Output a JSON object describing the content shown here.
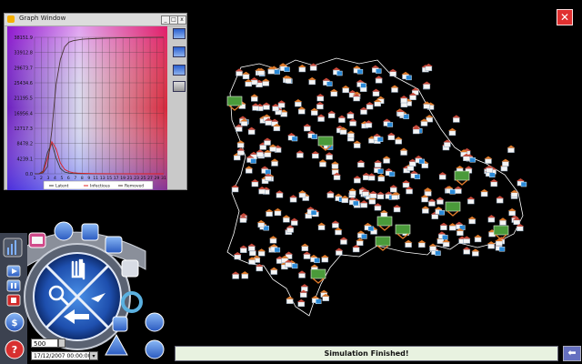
{
  "graph_window": {
    "title": "Graph Window",
    "y_ticks": [
      "38151.9",
      "33912.8",
      "29673.7",
      "25434.6",
      "21195.5",
      "16956.4",
      "12717.3",
      "8478.2",
      "4239.1",
      "0.0"
    ],
    "x_ticks": [
      "1",
      "2",
      "3",
      "4",
      "5",
      "6",
      "7",
      "8",
      "9",
      "11",
      "13",
      "15",
      "17",
      "19",
      "21",
      "23",
      "25",
      "27",
      "29",
      "31"
    ],
    "legend": [
      "Latent",
      "Infectious",
      "Removed"
    ],
    "minimize_label": "_",
    "maximize_label": "□",
    "close_label": "x"
  },
  "chart_data": {
    "type": "line",
    "x": [
      1,
      2,
      3,
      4,
      5,
      6,
      7,
      8,
      9,
      10,
      11,
      12,
      13,
      15,
      17,
      19,
      21,
      23,
      25,
      27,
      29,
      31
    ],
    "series": [
      {
        "name": "Latent",
        "values": [
          0,
          0,
          800,
          6000,
          8478,
          4500,
          1500,
          500,
          200,
          80,
          40,
          20,
          10,
          5,
          0,
          0,
          0,
          0,
          0,
          0,
          0,
          0
        ]
      },
      {
        "name": "Infectious",
        "values": [
          0,
          0,
          500,
          4239,
          9000,
          7000,
          3000,
          1200,
          600,
          300,
          200,
          150,
          100,
          50,
          30,
          20,
          10,
          0,
          0,
          0,
          0,
          0
        ]
      },
      {
        "name": "Removed",
        "values": [
          0,
          0,
          300,
          2000,
          12000,
          25000,
          32000,
          35500,
          36800,
          37200,
          37400,
          37600,
          37700,
          37800,
          37900,
          37950,
          38000,
          38050,
          38100,
          38120,
          38140,
          38151.9
        ]
      }
    ],
    "ylim": [
      0,
      38151.9
    ],
    "colors": {
      "Latent": "#3a3a3a",
      "Infectious": "#e02020",
      "Removed": "#4a3535"
    }
  },
  "status": {
    "message": "Simulation Finished!"
  },
  "controls": {
    "speed_value": "500",
    "date_value": "17/12/2007 00:00:00",
    "back_label": "⬅",
    "close_label": "✕"
  },
  "icons": {
    "wheel": [
      "pan-hand-icon",
      "zoom-magnifier-icon",
      "reset-arrow-icon",
      "select-cursor-icon"
    ],
    "arc_buttons": [
      "chart-icon",
      "new-sim-icon",
      "document-icon",
      "edit-icon",
      "save-icon",
      "settings-ring-icon",
      "globe-icon",
      "layers-icon",
      "ruler-icon"
    ],
    "left_buttons": [
      "stats-bar-icon",
      "play-icon",
      "pause-icon",
      "stop-icon",
      "money-bag-icon",
      "help-icon"
    ]
  }
}
